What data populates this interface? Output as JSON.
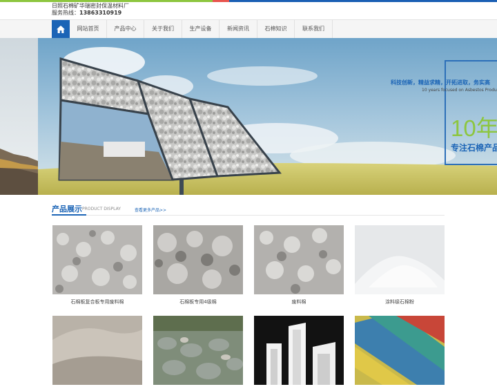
{
  "header": {
    "company_name": "日照石棉矿华瑞密封保温材料厂",
    "hotline_label": "服务热线：",
    "hotline_number": "13863310919"
  },
  "nav": {
    "home_icon": "home-icon",
    "items": [
      "网站首页",
      "产品中心",
      "关于我们",
      "生产设备",
      "新闻资讯",
      "石棉知识",
      "联系我们"
    ]
  },
  "banner": {
    "slogan": "科技创新，精益求精，开拓进取，务实高",
    "slogan_en": "10 years focused on Asbestos Produ",
    "big_number": "10年",
    "focus_text": "专注石棉产品"
  },
  "section": {
    "title": "产品展示",
    "title_en": "PRODUCT DISPLAY",
    "more_link": "查看更多产品>>"
  },
  "products": [
    {
      "caption": "石棉板复合板专用废料棉"
    },
    {
      "caption": "石棉板专用4级棉"
    },
    {
      "caption": "废料棉"
    },
    {
      "caption": "涂料级石棉粉"
    },
    {
      "caption": ""
    },
    {
      "caption": ""
    },
    {
      "caption": ""
    },
    {
      "caption": ""
    }
  ],
  "colors": {
    "accent": "#1b64b6",
    "green": "#8dc63f",
    "red": "#e8544e"
  }
}
